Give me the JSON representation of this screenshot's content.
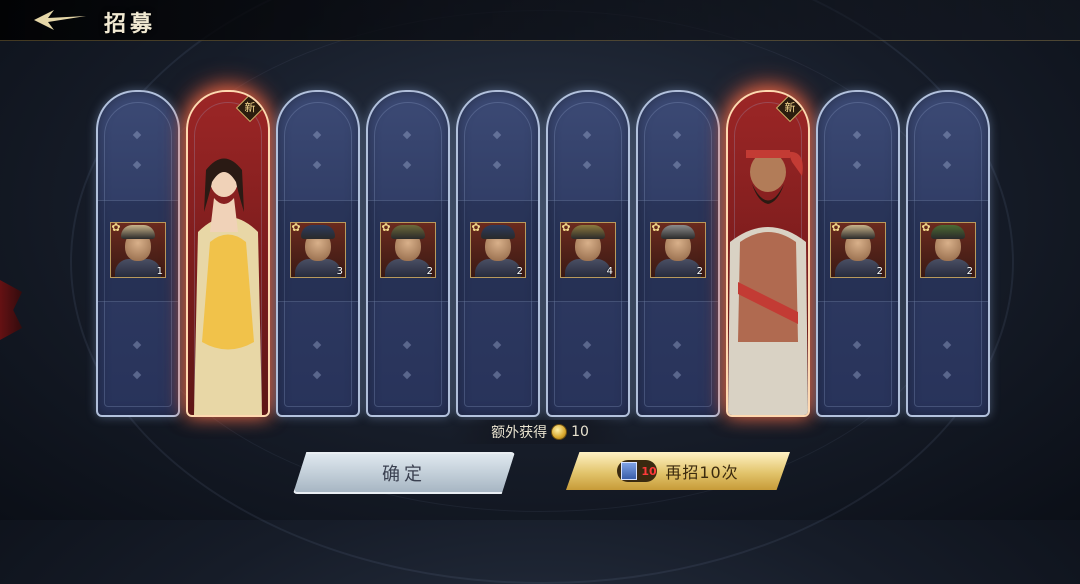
{
  "header": {
    "title": "招募",
    "back_icon": "back-arrow-icon"
  },
  "cards": [
    {
      "type": "portrait",
      "stars": "1",
      "new": false,
      "helm": "#c9b48a"
    },
    {
      "type": "full",
      "stars": "",
      "new": true,
      "new_label": "新",
      "variant": "lady"
    },
    {
      "type": "portrait",
      "stars": "3",
      "new": false,
      "helm": "#2c3b5e"
    },
    {
      "type": "portrait",
      "stars": "2",
      "new": false,
      "helm": "#6e6a3a"
    },
    {
      "type": "portrait",
      "stars": "2",
      "new": false,
      "helm": "#2c3b5e"
    },
    {
      "type": "portrait",
      "stars": "4",
      "new": false,
      "helm": "#8e7a3e"
    },
    {
      "type": "portrait",
      "stars": "2",
      "new": false,
      "helm": "#8c8c8c"
    },
    {
      "type": "full",
      "stars": "",
      "new": true,
      "new_label": "新",
      "variant": "warrior"
    },
    {
      "type": "portrait",
      "stars": "2",
      "new": false,
      "helm": "#c9b48a"
    },
    {
      "type": "portrait",
      "stars": "2",
      "new": false,
      "helm": "#4c6b33"
    }
  ],
  "extra": {
    "label": "额外获得",
    "amount": "10"
  },
  "buttons": {
    "confirm": "确定",
    "again": "再招10次",
    "again_cost": "10"
  }
}
